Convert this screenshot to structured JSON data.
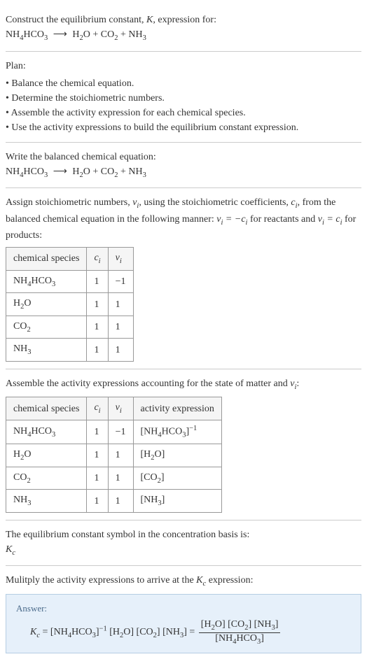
{
  "intro": {
    "line1_a": "Construct the equilibrium constant, ",
    "line1_b": ", expression for:",
    "K": "K",
    "eq_lhs": "NH",
    "eq_lhs2": "HCO",
    "eq_rhs_h2o": "H",
    "eq_rhs_o": "O + CO",
    "eq_rhs_nh3": " + NH"
  },
  "plan": {
    "title": "Plan:",
    "items": [
      "Balance the chemical equation.",
      "Determine the stoichiometric numbers.",
      "Assemble the activity expression for each chemical species.",
      "Use the activity expressions to build the equilibrium constant expression."
    ]
  },
  "balanced": {
    "title": "Write the balanced chemical equation:"
  },
  "stoich": {
    "intro_a": "Assign stoichiometric numbers, ",
    "intro_b": ", using the stoichiometric coefficients, ",
    "intro_c": ", from the balanced chemical equation in the following manner: ",
    "intro_d": " for reactants and ",
    "intro_e": " for products:",
    "nu_i": "ν",
    "c_i": "c",
    "eq_react": "ν",
    "eq_react2": " = −c",
    "eq_prod": "ν",
    "eq_prod2": " = c",
    "headers": [
      "chemical species",
      "c",
      "ν"
    ],
    "rows": [
      {
        "species_a": "NH",
        "sub1": "4",
        "species_b": "HCO",
        "sub2": "3",
        "c": "1",
        "nu": "−1"
      },
      {
        "species_a": "H",
        "sub1": "2",
        "species_b": "O",
        "sub2": "",
        "c": "1",
        "nu": "1"
      },
      {
        "species_a": "CO",
        "sub1": "2",
        "species_b": "",
        "sub2": "",
        "c": "1",
        "nu": "1"
      },
      {
        "species_a": "NH",
        "sub1": "3",
        "species_b": "",
        "sub2": "",
        "c": "1",
        "nu": "1"
      }
    ]
  },
  "activity": {
    "intro_a": "Assemble the activity expressions accounting for the state of matter and ",
    "intro_b": ":",
    "headers": [
      "chemical species",
      "c",
      "ν",
      "activity expression"
    ],
    "rows": [
      {
        "species_a": "NH",
        "sub1": "4",
        "species_b": "HCO",
        "sub2": "3",
        "c": "1",
        "nu": "−1",
        "act_a": "[NH",
        "act_s1": "4",
        "act_b": "HCO",
        "act_s2": "3",
        "act_c": "]",
        "exp": "−1"
      },
      {
        "species_a": "H",
        "sub1": "2",
        "species_b": "O",
        "sub2": "",
        "c": "1",
        "nu": "1",
        "act_a": "[H",
        "act_s1": "2",
        "act_b": "O]",
        "act_s2": "",
        "act_c": "",
        "exp": ""
      },
      {
        "species_a": "CO",
        "sub1": "2",
        "species_b": "",
        "sub2": "",
        "c": "1",
        "nu": "1",
        "act_a": "[CO",
        "act_s1": "2",
        "act_b": "]",
        "act_s2": "",
        "act_c": "",
        "exp": ""
      },
      {
        "species_a": "NH",
        "sub1": "3",
        "species_b": "",
        "sub2": "",
        "c": "1",
        "nu": "1",
        "act_a": "[NH",
        "act_s1": "3",
        "act_b": "]",
        "act_s2": "",
        "act_c": "",
        "exp": ""
      }
    ]
  },
  "symbol": {
    "text": "The equilibrium constant symbol in the concentration basis is:",
    "kc_K": "K",
    "kc_c": "c"
  },
  "multiply": {
    "text_a": "Mulitply the activity expressions to arrive at the ",
    "text_b": " expression:"
  },
  "answer": {
    "label": "Answer:",
    "Kc_K": "K",
    "Kc_c": "c",
    "eq": " = ",
    "t1_a": "[NH",
    "t1_s1": "4",
    "t1_b": "HCO",
    "t1_s2": "3",
    "t1_c": "]",
    "t1_exp": "−1",
    "t2_a": " [H",
    "t2_s1": "2",
    "t2_b": "O]",
    "t3_a": " [CO",
    "t3_s1": "2",
    "t3_b": "]",
    "t4_a": " [NH",
    "t4_s1": "3",
    "t4_b": "]",
    "eq2": " = ",
    "num_a": "[H",
    "num_s1": "2",
    "num_b": "O] [CO",
    "num_s2": "2",
    "num_c": "] [NH",
    "num_s3": "3",
    "num_d": "]",
    "den_a": "[NH",
    "den_s1": "4",
    "den_b": "HCO",
    "den_s2": "3",
    "den_c": "]"
  },
  "subs": {
    "i": "i",
    "4": "4",
    "3": "3",
    "2": "2"
  }
}
